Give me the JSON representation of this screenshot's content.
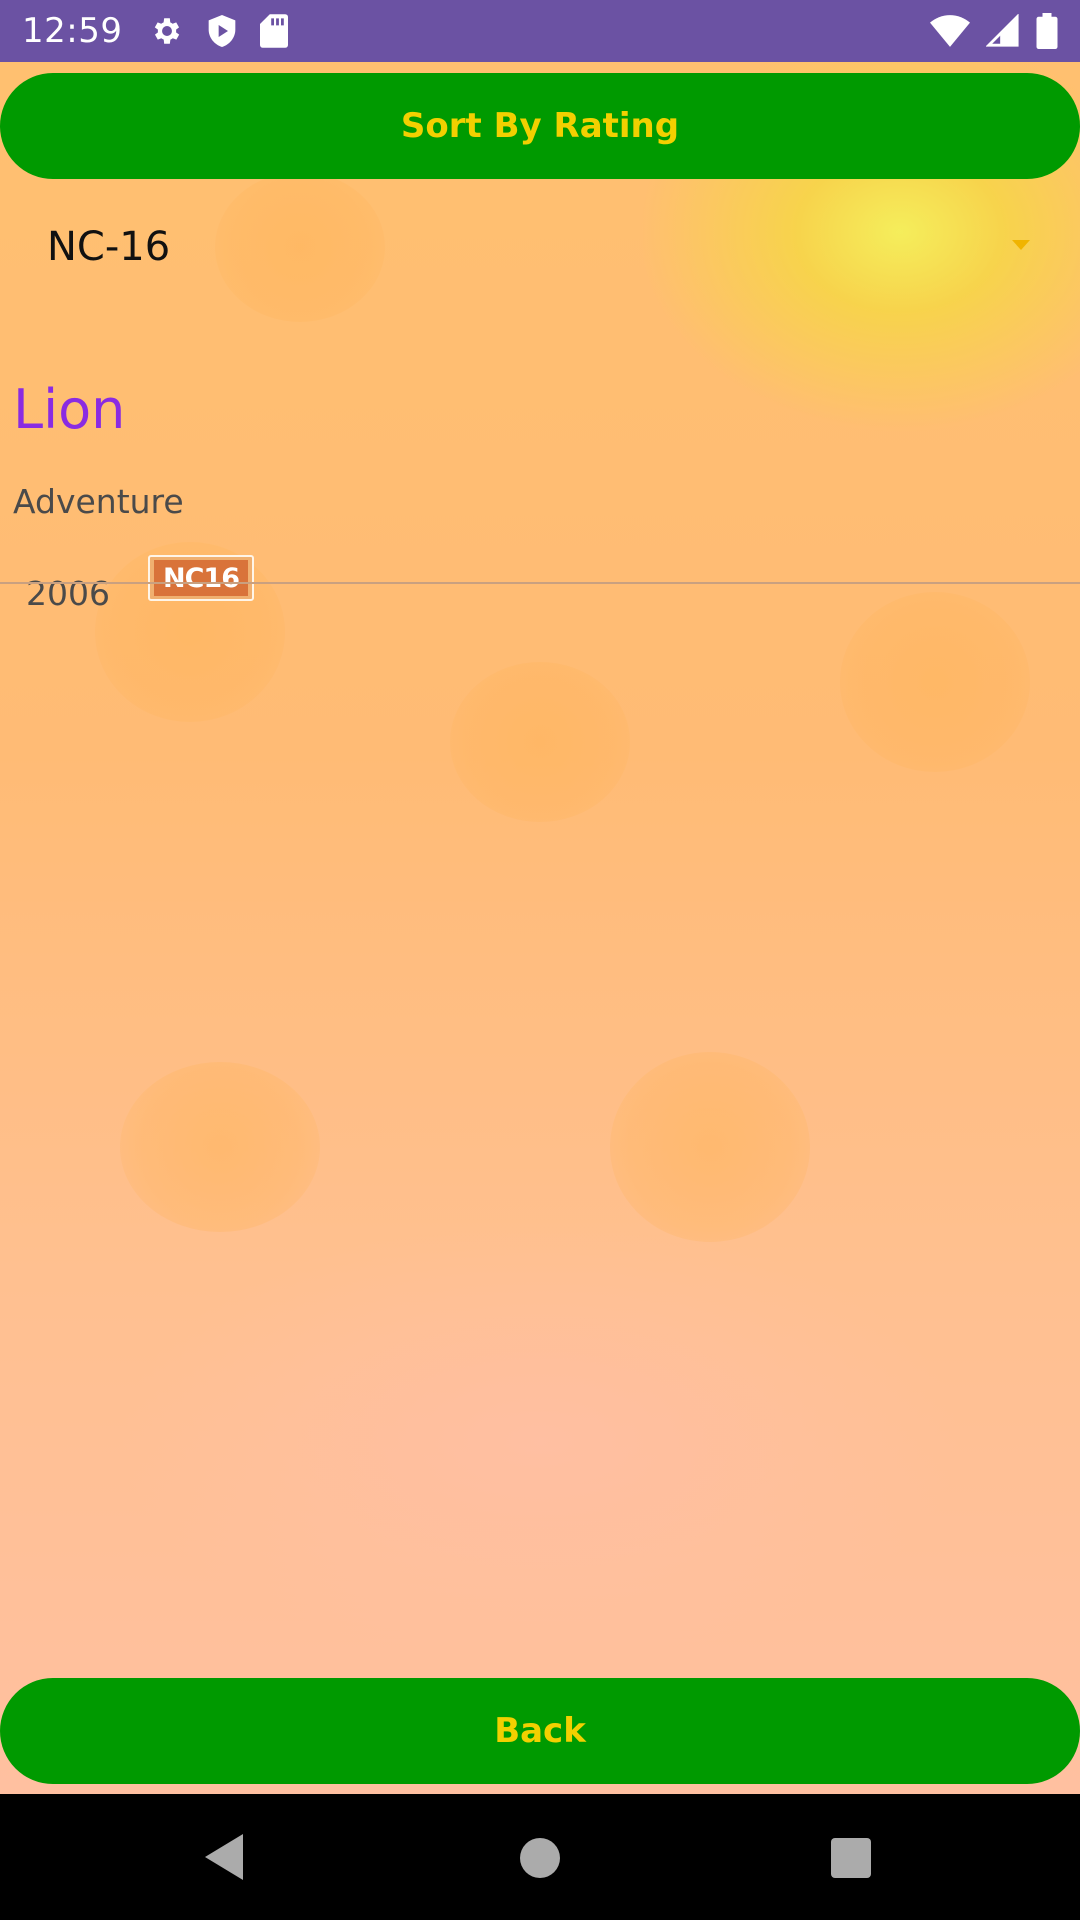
{
  "status_bar": {
    "time": "12:59",
    "left_icons": [
      "gear-icon",
      "shield-play-icon",
      "sd-card-icon"
    ],
    "right_icons": [
      "wifi-icon",
      "signal-icon",
      "battery-icon"
    ],
    "background": "#6b52a3"
  },
  "toolbar": {
    "sort_label": "Sort By Rating"
  },
  "filter": {
    "selected_rating": "NC-16"
  },
  "movies": [
    {
      "title": "Lion",
      "genre": "Adventure",
      "year": "2006",
      "rating_badge": "NC16"
    }
  ],
  "footer": {
    "back_label": "Back"
  },
  "colors": {
    "button_bg": "#009a00",
    "button_text": "#f2d000",
    "title_color": "#8a2be2"
  },
  "nav_bar": {
    "icons": [
      "back-triangle-icon",
      "home-circle-icon",
      "recents-square-icon"
    ]
  }
}
